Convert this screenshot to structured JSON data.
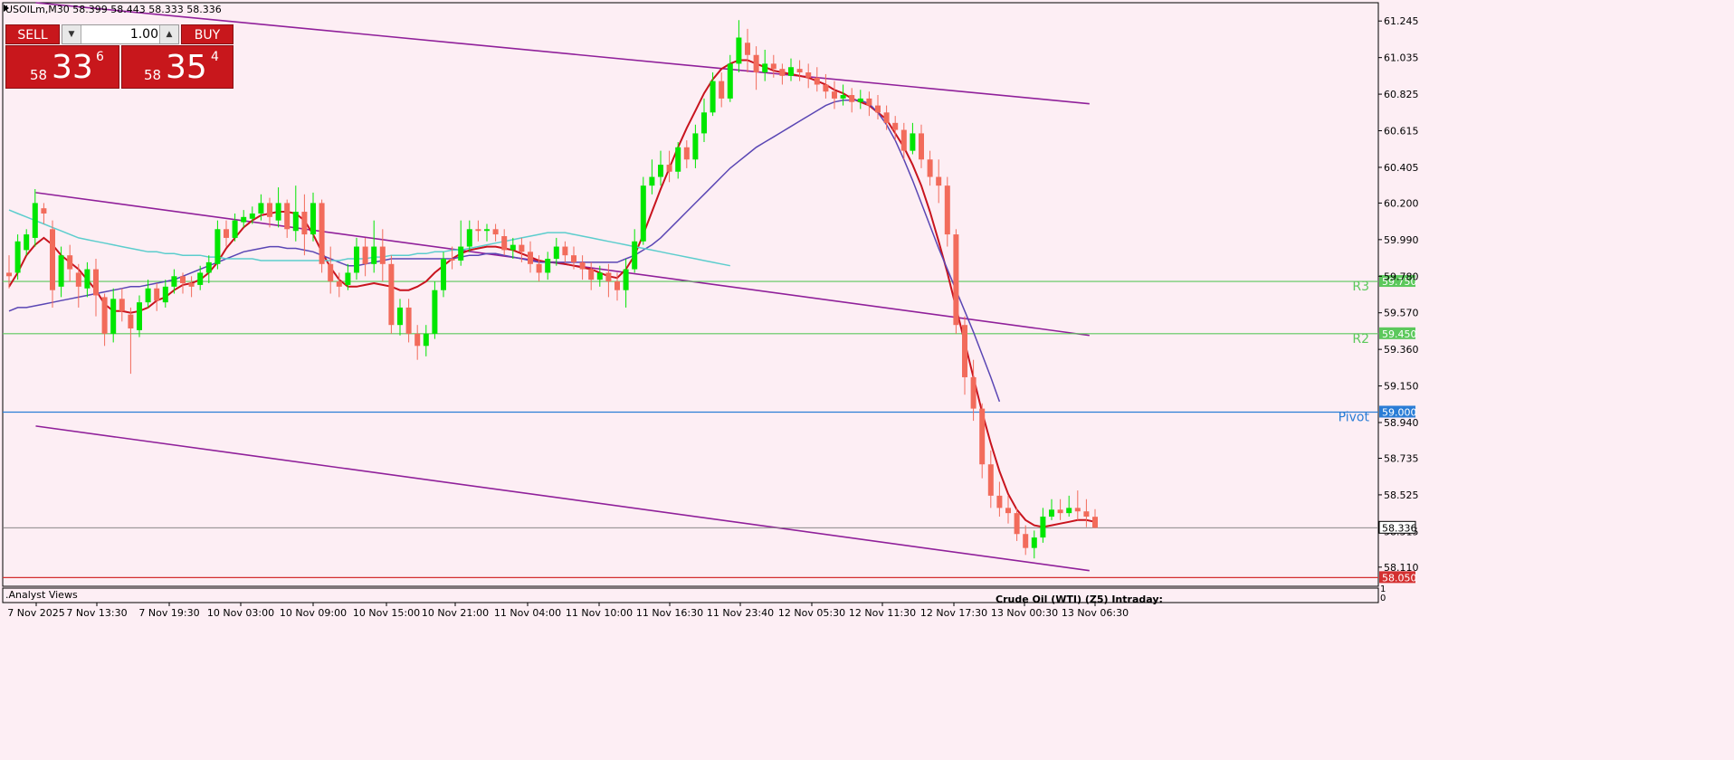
{
  "header": {
    "symbol": "USOILm,M30",
    "ohlc": "58.399 58.443 58.333 58.336"
  },
  "trade_panel": {
    "sell_label": "SELL",
    "buy_label": "BUY",
    "lot_value": "1.00",
    "sell_price": {
      "prefix": "58",
      "big": "33",
      "sup": "6"
    },
    "buy_price": {
      "prefix": "58",
      "big": "35",
      "sup": "4"
    }
  },
  "bottom": {
    "analyst_views": ".Analyst Views",
    "indicator_title": "Crude Oil (WTI) (Z5) Intraday:",
    "sub_axis_top": "1",
    "sub_axis_bottom": "0"
  },
  "colors": {
    "bull": "#00e600",
    "bear": "#f26b5b",
    "ma_fast": "#c8141e",
    "ma_mid": "#5a46b4",
    "ma_slow": "#5ccdcd",
    "channel": "#90209a",
    "pivot": "#2a7dd6",
    "level": "#5cc85c",
    "support": "#d43030",
    "price_line": "#7a7a7a"
  },
  "chart_data": {
    "type": "candlestick",
    "timeframe": "M30",
    "ylim": [
      58.0,
      61.35
    ],
    "x_tick_labels": [
      "7 Nov 2025",
      "7 Nov 13:30",
      "7 Nov 19:30",
      "10 Nov 03:00",
      "10 Nov 09:00",
      "10 Nov 15:00",
      "10 Nov 21:00",
      "11 Nov 04:00",
      "11 Nov 10:00",
      "11 Nov 16:30",
      "11 Nov 23:40",
      "12 Nov 05:30",
      "12 Nov 11:30",
      "12 Nov 17:30",
      "13 Nov 00:30",
      "13 Nov 06:30"
    ],
    "y_ticks": [
      "61.245",
      "61.035",
      "60.825",
      "60.615",
      "60.405",
      "60.200",
      "59.990",
      "59.780",
      "59.570",
      "59.360",
      "59.150",
      "58.940",
      "58.735",
      "58.525",
      "58.315",
      "58.110"
    ],
    "levels": [
      {
        "name": "R3",
        "value": 59.75,
        "label": "59.750",
        "color": "#5cc85c"
      },
      {
        "name": "R2",
        "value": 59.45,
        "label": "59.450",
        "color": "#5cc85c"
      },
      {
        "name": "Pivot",
        "value": 59.0,
        "label": "59.000",
        "color": "#2a7dd6"
      },
      {
        "name": "",
        "value": 58.05,
        "label": "58.050",
        "color": "#d43030"
      }
    ],
    "current_price": {
      "value": 58.336,
      "label": "58.336"
    },
    "channel_lines": [
      {
        "x1": 0.024,
        "y1": 61.35,
        "x2": 0.79,
        "y2": 60.77
      },
      {
        "x1": 0.024,
        "y1": 60.26,
        "x2": 0.79,
        "y2": 59.44
      },
      {
        "x1": 0.024,
        "y1": 58.92,
        "x2": 0.79,
        "y2": 58.09
      }
    ],
    "candles": [
      [
        59.8,
        59.78,
        59.9,
        59.71
      ],
      [
        59.8,
        59.98,
        60.02,
        59.76
      ],
      [
        59.93,
        60.02,
        60.05,
        59.9
      ],
      [
        60.0,
        60.2,
        60.28,
        59.95
      ],
      [
        60.17,
        60.14,
        60.2,
        60.08
      ],
      [
        60.05,
        59.7,
        60.1,
        59.6
      ],
      [
        59.72,
        59.9,
        59.95,
        59.66
      ],
      [
        59.9,
        59.82,
        59.96,
        59.75
      ],
      [
        59.8,
        59.72,
        59.85,
        59.6
      ],
      [
        59.71,
        59.82,
        59.86,
        59.66
      ],
      [
        59.82,
        59.67,
        59.88,
        59.55
      ],
      [
        59.66,
        59.45,
        59.68,
        59.38
      ],
      [
        59.45,
        59.65,
        59.71,
        59.4
      ],
      [
        59.65,
        59.58,
        59.71,
        59.52
      ],
      [
        59.56,
        59.48,
        59.6,
        59.22
      ],
      [
        59.47,
        59.63,
        59.67,
        59.43
      ],
      [
        59.63,
        59.71,
        59.76,
        59.6
      ],
      [
        59.71,
        59.64,
        59.74,
        59.58
      ],
      [
        59.63,
        59.72,
        59.76,
        59.6
      ],
      [
        59.72,
        59.78,
        59.82,
        59.68
      ],
      [
        59.78,
        59.74,
        59.8,
        59.68
      ],
      [
        59.74,
        59.72,
        59.78,
        59.66
      ],
      [
        59.73,
        59.8,
        59.84,
        59.7
      ],
      [
        59.8,
        59.86,
        59.9,
        59.74
      ],
      [
        59.85,
        60.05,
        60.1,
        59.82
      ],
      [
        60.05,
        60.0,
        60.1,
        59.95
      ],
      [
        60.0,
        60.1,
        60.14,
        59.98
      ],
      [
        60.09,
        60.12,
        60.16,
        60.06
      ],
      [
        60.11,
        60.14,
        60.18,
        60.08
      ],
      [
        60.14,
        60.2,
        60.25,
        60.1
      ],
      [
        60.2,
        60.12,
        60.23,
        60.06
      ],
      [
        60.1,
        60.2,
        60.29,
        60.06
      ],
      [
        60.2,
        60.05,
        60.22,
        60.0
      ],
      [
        60.04,
        60.15,
        60.3,
        59.98
      ],
      [
        60.15,
        60.02,
        60.25,
        59.9
      ],
      [
        60.02,
        60.2,
        60.26,
        59.98
      ],
      [
        60.2,
        59.85,
        60.22,
        59.8
      ],
      [
        59.85,
        59.75,
        59.95,
        59.68
      ],
      [
        59.75,
        59.72,
        59.8,
        59.66
      ],
      [
        59.73,
        59.8,
        59.85,
        59.7
      ],
      [
        59.8,
        59.95,
        60.0,
        59.76
      ],
      [
        59.95,
        59.85,
        60.0,
        59.78
      ],
      [
        59.85,
        59.95,
        60.1,
        59.8
      ],
      [
        59.95,
        59.85,
        60.05,
        59.75
      ],
      [
        59.85,
        59.5,
        59.9,
        59.45
      ],
      [
        59.5,
        59.6,
        59.65,
        59.44
      ],
      [
        59.6,
        59.45,
        59.65,
        59.4
      ],
      [
        59.45,
        59.38,
        59.5,
        59.3
      ],
      [
        59.38,
        59.45,
        59.5,
        59.32
      ],
      [
        59.45,
        59.7,
        59.75,
        59.42
      ],
      [
        59.7,
        59.88,
        59.92,
        59.66
      ],
      [
        59.88,
        59.87,
        59.95,
        59.82
      ],
      [
        59.87,
        59.95,
        60.1,
        59.84
      ],
      [
        59.95,
        60.05,
        60.1,
        59.92
      ],
      [
        60.05,
        60.04,
        60.1,
        59.98
      ],
      [
        60.04,
        60.05,
        60.08,
        59.98
      ],
      [
        60.05,
        60.02,
        60.08,
        59.98
      ],
      [
        60.01,
        59.93,
        60.05,
        59.9
      ],
      [
        59.93,
        59.96,
        60.0,
        59.88
      ],
      [
        59.96,
        59.92,
        60.0,
        59.86
      ],
      [
        59.92,
        59.85,
        59.98,
        59.8
      ],
      [
        59.85,
        59.8,
        59.9,
        59.75
      ],
      [
        59.8,
        59.88,
        59.92,
        59.76
      ],
      [
        59.88,
        59.95,
        60.0,
        59.84
      ],
      [
        59.95,
        59.9,
        59.98,
        59.86
      ],
      [
        59.9,
        59.86,
        59.95,
        59.82
      ],
      [
        59.86,
        59.82,
        59.9,
        59.76
      ],
      [
        59.82,
        59.76,
        59.86,
        59.7
      ],
      [
        59.76,
        59.8,
        59.84,
        59.72
      ],
      [
        59.8,
        59.75,
        59.85,
        59.66
      ],
      [
        59.75,
        59.7,
        59.8,
        59.64
      ],
      [
        59.7,
        59.82,
        59.88,
        59.6
      ],
      [
        59.82,
        59.98,
        60.05,
        59.8
      ],
      [
        59.98,
        60.3,
        60.35,
        59.96
      ],
      [
        60.3,
        60.35,
        60.45,
        60.25
      ],
      [
        60.35,
        60.42,
        60.5,
        60.3
      ],
      [
        60.42,
        60.38,
        60.5,
        60.32
      ],
      [
        60.38,
        60.52,
        60.55,
        60.34
      ],
      [
        60.52,
        60.45,
        60.56,
        60.4
      ],
      [
        60.45,
        60.6,
        60.65,
        60.4
      ],
      [
        60.6,
        60.72,
        60.8,
        60.55
      ],
      [
        60.72,
        60.9,
        60.95,
        60.7
      ],
      [
        60.9,
        60.8,
        60.95,
        60.75
      ],
      [
        60.8,
        61.0,
        61.05,
        60.78
      ],
      [
        61.0,
        61.15,
        61.25,
        60.95
      ],
      [
        61.12,
        61.05,
        61.2,
        60.95
      ],
      [
        61.05,
        60.95,
        61.1,
        60.85
      ],
      [
        60.95,
        61.0,
        61.08,
        60.9
      ],
      [
        61.0,
        60.97,
        61.05,
        60.92
      ],
      [
        60.97,
        60.93,
        61.0,
        60.88
      ],
      [
        60.93,
        60.98,
        61.03,
        60.9
      ],
      [
        60.97,
        60.95,
        61.02,
        60.9
      ],
      [
        60.95,
        60.92,
        61.0,
        60.86
      ],
      [
        60.92,
        60.88,
        60.98,
        60.84
      ],
      [
        60.88,
        60.84,
        60.94,
        60.8
      ],
      [
        60.84,
        60.8,
        60.9,
        60.74
      ],
      [
        60.8,
        60.82,
        60.88,
        60.76
      ],
      [
        60.82,
        60.78,
        60.86,
        60.72
      ],
      [
        60.78,
        60.8,
        60.85,
        60.74
      ],
      [
        60.8,
        60.76,
        60.84,
        60.7
      ],
      [
        60.76,
        60.72,
        60.82,
        60.68
      ],
      [
        60.72,
        60.66,
        60.76,
        60.62
      ],
      [
        60.66,
        60.62,
        60.7,
        60.56
      ],
      [
        60.62,
        60.5,
        60.66,
        60.45
      ],
      [
        60.5,
        60.6,
        60.66,
        60.48
      ],
      [
        60.6,
        60.45,
        60.65,
        60.4
      ],
      [
        60.45,
        60.35,
        60.5,
        60.3
      ],
      [
        60.35,
        60.3,
        60.45,
        60.2
      ],
      [
        60.3,
        60.02,
        60.35,
        59.95
      ],
      [
        60.02,
        59.5,
        60.05,
        59.45
      ],
      [
        59.5,
        59.2,
        59.55,
        59.1
      ],
      [
        59.2,
        59.02,
        59.3,
        58.95
      ],
      [
        59.02,
        58.7,
        59.05,
        58.62
      ],
      [
        58.7,
        58.52,
        58.78,
        58.45
      ],
      [
        58.52,
        58.45,
        58.6,
        58.4
      ],
      [
        58.45,
        58.42,
        58.52,
        58.36
      ],
      [
        58.42,
        58.3,
        58.45,
        58.26
      ],
      [
        58.3,
        58.22,
        58.35,
        58.18
      ],
      [
        58.22,
        58.28,
        58.32,
        58.16
      ],
      [
        58.28,
        58.4,
        58.45,
        58.25
      ],
      [
        58.4,
        58.44,
        58.5,
        58.38
      ],
      [
        58.44,
        58.42,
        58.5,
        58.38
      ],
      [
        58.42,
        58.45,
        58.52,
        58.4
      ],
      [
        58.45,
        58.43,
        58.55,
        58.38
      ],
      [
        58.43,
        58.4,
        58.5,
        58.34
      ],
      [
        58.399,
        58.336,
        58.443,
        58.333
      ]
    ],
    "series": [
      {
        "name": "",
        "color": "#c8141e",
        "values": [
          59.72,
          59.8,
          59.9,
          59.96,
          60.0,
          59.96,
          59.9,
          59.86,
          59.82,
          59.76,
          59.7,
          59.62,
          59.58,
          59.58,
          59.57,
          59.58,
          59.6,
          59.64,
          59.66,
          59.7,
          59.73,
          59.74,
          59.76,
          59.8,
          59.86,
          59.94,
          60.0,
          60.06,
          60.1,
          60.13,
          60.14,
          60.15,
          60.15,
          60.14,
          60.1,
          60.02,
          59.92,
          59.83,
          59.76,
          59.72,
          59.72,
          59.73,
          59.74,
          59.73,
          59.72,
          59.7,
          59.7,
          59.72,
          59.75,
          59.8,
          59.84,
          59.88,
          59.91,
          59.93,
          59.94,
          59.95,
          59.95,
          59.94,
          59.93,
          59.91,
          59.89,
          59.87,
          59.86,
          59.86,
          59.85,
          59.84,
          59.83,
          59.82,
          59.8,
          59.78,
          59.77,
          59.82,
          59.9,
          60.02,
          60.15,
          60.28,
          60.4,
          60.52,
          60.63,
          60.73,
          60.83,
          60.91,
          60.97,
          61.0,
          61.02,
          61.02,
          61.0,
          60.98,
          60.96,
          60.95,
          60.94,
          60.93,
          60.92,
          60.9,
          60.88,
          60.85,
          60.83,
          60.8,
          60.78,
          60.76,
          60.72,
          60.68,
          60.6,
          60.52,
          60.42,
          60.3,
          60.15,
          59.98,
          59.8,
          59.6,
          59.4,
          59.2,
          59.0,
          58.82,
          58.66,
          58.53,
          58.44,
          58.38,
          58.35,
          58.34,
          58.35,
          58.36,
          58.37,
          58.38,
          58.38,
          58.37
        ]
      },
      {
        "name": "",
        "color": "#5a46b4",
        "values": [
          59.58,
          59.6,
          59.6,
          59.61,
          59.62,
          59.63,
          59.64,
          59.65,
          59.66,
          59.67,
          59.68,
          59.69,
          59.7,
          59.71,
          59.72,
          59.72,
          59.73,
          59.74,
          59.75,
          59.76,
          59.78,
          59.8,
          59.82,
          59.84,
          59.86,
          59.88,
          59.9,
          59.92,
          59.93,
          59.94,
          59.95,
          59.95,
          59.94,
          59.94,
          59.93,
          59.92,
          59.9,
          59.88,
          59.86,
          59.84,
          59.84,
          59.85,
          59.86,
          59.87,
          59.88,
          59.88,
          59.88,
          59.88,
          59.88,
          59.88,
          59.88,
          59.88,
          59.89,
          59.9,
          59.9,
          59.91,
          59.91,
          59.9,
          59.89,
          59.88,
          59.87,
          59.86,
          59.86,
          59.86,
          59.86,
          59.86,
          59.86,
          59.86,
          59.86,
          59.86,
          59.86,
          59.88,
          59.9,
          59.93,
          59.96,
          60.0,
          60.05,
          60.1,
          60.15,
          60.2,
          60.25,
          60.3,
          60.35,
          60.4,
          60.44,
          60.48,
          60.52,
          60.55,
          60.58,
          60.61,
          60.64,
          60.67,
          60.7,
          60.73,
          60.76,
          60.78,
          60.79,
          60.79,
          60.79,
          60.77,
          60.72,
          60.65,
          60.56,
          60.45,
          60.33,
          60.2,
          60.07,
          59.94,
          59.82,
          59.7,
          59.58,
          59.46,
          59.33,
          59.2,
          59.06
        ]
      },
      {
        "name": "",
        "color": "#5ccdcd",
        "values": [
          60.16,
          60.14,
          60.12,
          60.1,
          60.08,
          60.06,
          60.04,
          60.02,
          60.0,
          59.99,
          59.98,
          59.97,
          59.96,
          59.95,
          59.94,
          59.93,
          59.92,
          59.92,
          59.91,
          59.91,
          59.9,
          59.9,
          59.9,
          59.89,
          59.89,
          59.88,
          59.88,
          59.88,
          59.88,
          59.87,
          59.87,
          59.87,
          59.87,
          59.87,
          59.87,
          59.87,
          59.87,
          59.87,
          59.87,
          59.88,
          59.88,
          59.88,
          59.89,
          59.89,
          59.9,
          59.9,
          59.9,
          59.91,
          59.91,
          59.92,
          59.92,
          59.93,
          59.93,
          59.94,
          59.95,
          59.96,
          59.97,
          59.98,
          59.99,
          60.0,
          60.01,
          60.02,
          60.03,
          60.03,
          60.03,
          60.02,
          60.01,
          60.0,
          59.99,
          59.98,
          59.97,
          59.96,
          59.95,
          59.94,
          59.93,
          59.92,
          59.91,
          59.9,
          59.89,
          59.88,
          59.87,
          59.86,
          59.85,
          59.84
        ]
      }
    ]
  }
}
